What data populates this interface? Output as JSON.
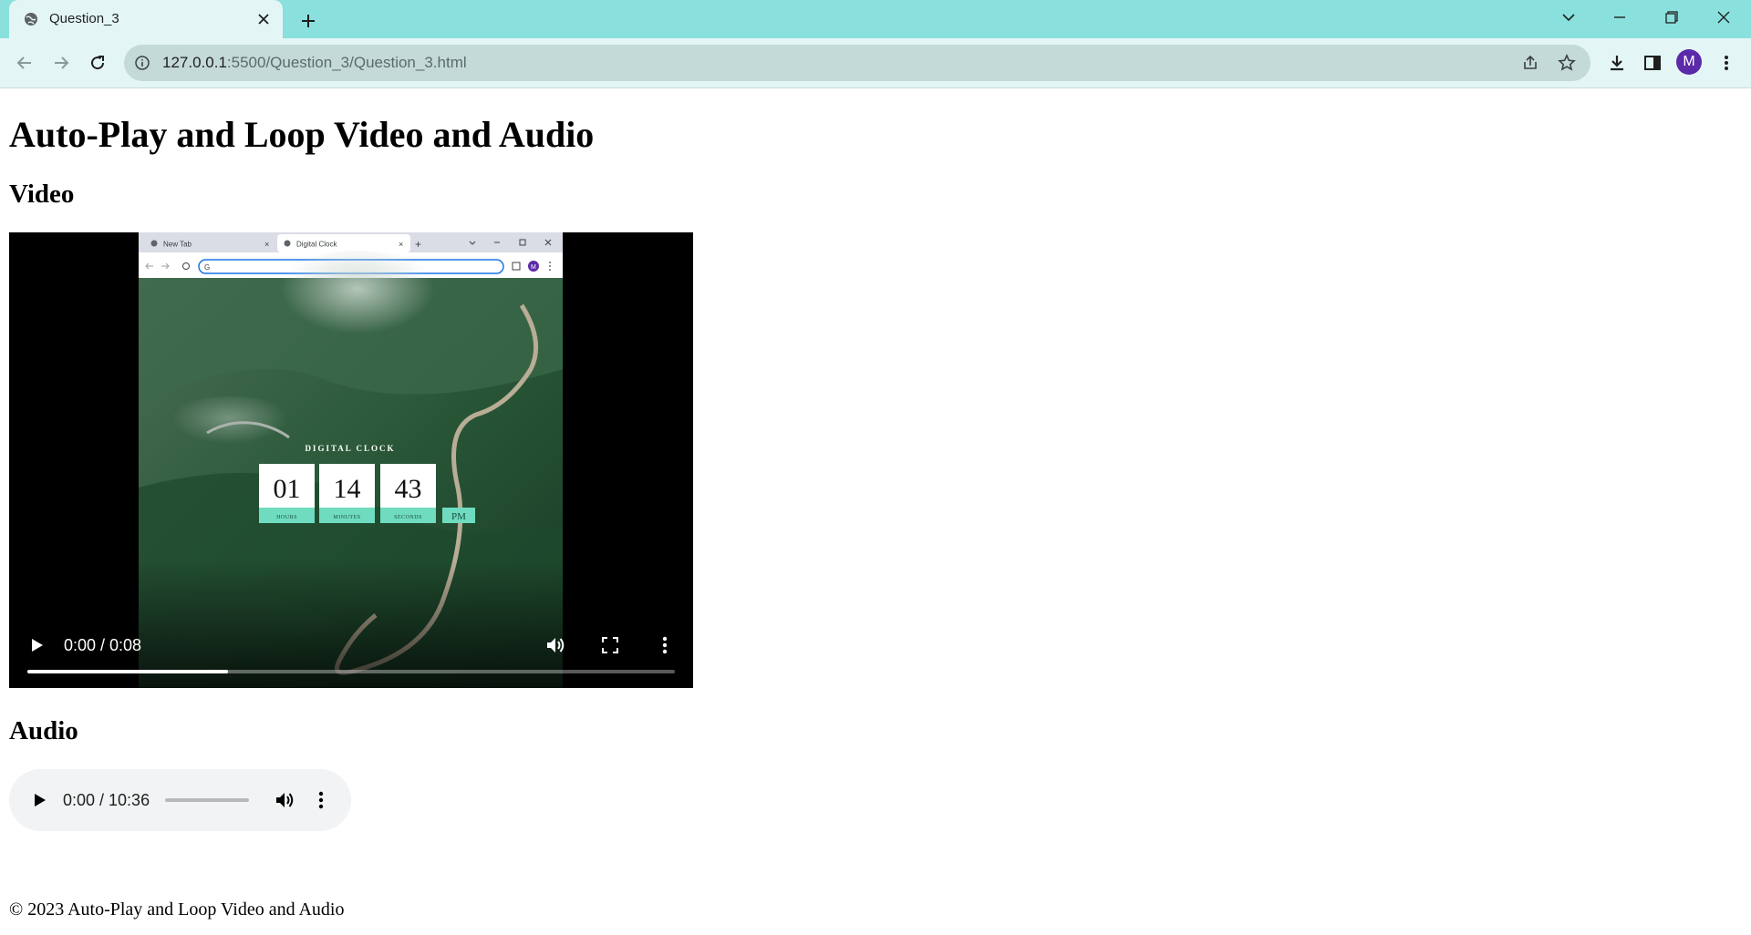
{
  "browser": {
    "tab_title": "Question_3",
    "url_host": "127.0.0.1",
    "url_path": ":5500/Question_3/Question_3.html",
    "profile_initial": "M",
    "accent": "#8ae0dc",
    "avatar_color": "#5b2aa8"
  },
  "page": {
    "title": "Auto-Play and Loop Video and Audio",
    "video_heading": "Video",
    "audio_heading": "Audio",
    "footer": "© 2023 Auto-Play and Loop Video and Audio"
  },
  "video": {
    "time": "0:00 / 0:08",
    "progress_fraction": 0.31,
    "frame": {
      "tab1": "New Tab",
      "tab2": "Digital Clock",
      "avatar": "M",
      "clock_title": "DIGITAL CLOCK",
      "hours": "01",
      "minutes": "14",
      "seconds": "43",
      "ampm": "PM",
      "hours_label": "HOURS",
      "minutes_label": "MINUTES",
      "seconds_label": "SECONDS"
    }
  },
  "audio": {
    "time": "0:00 / 10:36",
    "progress_fraction": 0
  }
}
